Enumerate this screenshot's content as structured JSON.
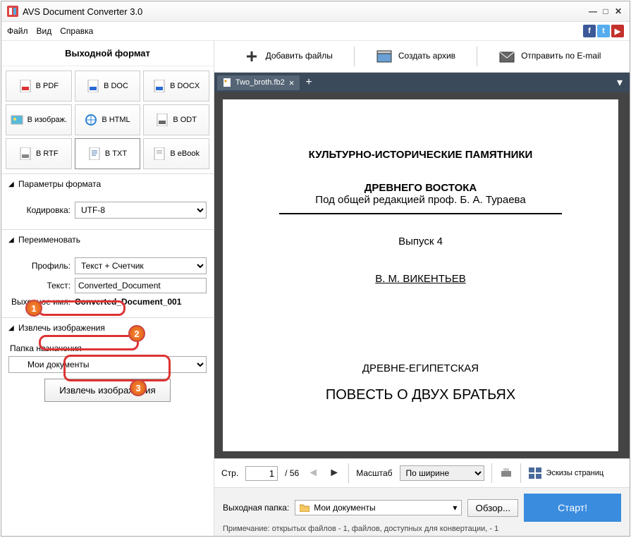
{
  "window": {
    "title": "AVS Document Converter 3.0"
  },
  "menu": {
    "file": "Файл",
    "view": "Вид",
    "help": "Справка"
  },
  "left": {
    "header": "Выходной формат",
    "formats": {
      "pdf": "В PDF",
      "doc": "В DOC",
      "docx": "В DOCX",
      "image": "В изображ.",
      "html": "В HTML",
      "odt": "В ODT",
      "rtf": "В RTF",
      "txt": "В TXT",
      "ebook": "В eBook"
    },
    "params": {
      "title": "Параметры формата",
      "encoding_label": "Кодировка:",
      "encoding_value": "UTF-8"
    },
    "rename": {
      "title": "Переименовать",
      "profile_label": "Профиль:",
      "profile_value": "Текст + Счетчик",
      "text_label": "Текст:",
      "text_value": "Converted_Document",
      "outname_label": "Выходное имя:",
      "outname_value": "Converted_Document_001"
    },
    "extract": {
      "title": "Извлечь изображения",
      "dest_label": "Папка назначения",
      "dest_value": "Мои документы",
      "button": "Извлечь изображения"
    }
  },
  "toolbar": {
    "add_files": "Добавить файлы",
    "create_archive": "Создать архив",
    "send_email": "Отправить по E-mail"
  },
  "tab": {
    "name": "Two_broth.fb2"
  },
  "preview": {
    "line1": "КУЛЬТУРНО-ИСТОРИЧЕСКИЕ ПАМЯТНИКИ",
    "line2": "ДРЕВНЕГО ВОСТОКА",
    "sub": "Под общей редакцией проф. Б. А. Тураева",
    "issue": "Выпуск 4",
    "author": "В. М. ВИКЕНТЬЕВ",
    "story1": "ДРЕВНЕ-ЕГИПЕТСКАЯ",
    "story2": "ПОВЕСТЬ О ДВУХ БРАТЬЯХ"
  },
  "pagenav": {
    "page_label": "Стр.",
    "page_current": "1",
    "page_total": "/ 56",
    "zoom_label": "Масштаб",
    "zoom_value": "По ширине",
    "thumbs": "Эскизы страниц"
  },
  "bottom": {
    "out_label": "Выходная папка:",
    "out_value": "Мои документы",
    "browse": "Обзор...",
    "start": "Старт!",
    "note": "Примечание: открытых файлов - 1, файлов, доступных для конвертации, - 1"
  },
  "badges": {
    "b1": "1",
    "b2": "2",
    "b3": "3"
  }
}
